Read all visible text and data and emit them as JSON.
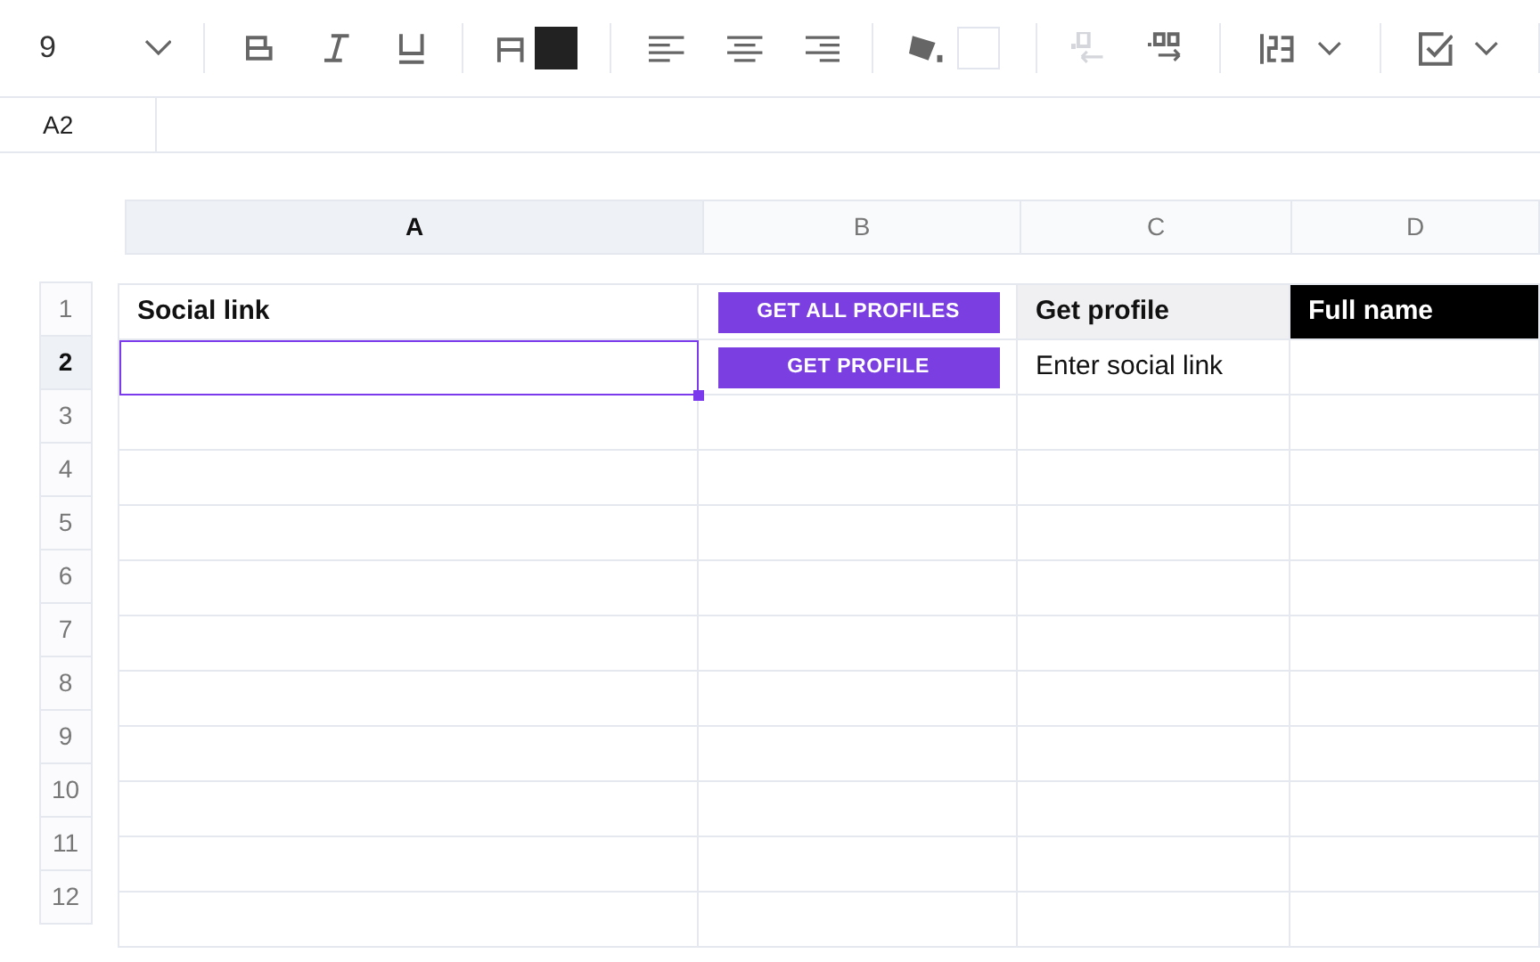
{
  "toolbar": {
    "font_size": "9",
    "decrease_decimals_disabled": true
  },
  "formula_bar": {
    "cell_ref": "A2"
  },
  "columns": [
    {
      "label": "A",
      "selected": true
    },
    {
      "label": "B",
      "selected": false
    },
    {
      "label": "C",
      "selected": false
    },
    {
      "label": "D",
      "selected": false
    }
  ],
  "rows": [
    {
      "number": "1",
      "selected": false,
      "cells": [
        {
          "kind": "bold",
          "text": "Social link"
        },
        {
          "kind": "button",
          "text": "GET ALL PROFILES"
        },
        {
          "kind": "header_light",
          "text": "Get profile"
        },
        {
          "kind": "header_dark",
          "text": "Full name"
        }
      ]
    },
    {
      "number": "2",
      "selected": true,
      "cells": [
        {
          "kind": "empty"
        },
        {
          "kind": "button",
          "text": "GET PROFILE"
        },
        {
          "kind": "text",
          "text": "Enter social link"
        },
        {
          "kind": "empty"
        }
      ]
    },
    {
      "number": "3",
      "selected": false,
      "cells": []
    },
    {
      "number": "4",
      "selected": false,
      "cells": []
    },
    {
      "number": "5",
      "selected": false,
      "cells": []
    },
    {
      "number": "6",
      "selected": false,
      "cells": []
    },
    {
      "number": "7",
      "selected": false,
      "cells": []
    },
    {
      "number": "8",
      "selected": false,
      "cells": []
    },
    {
      "number": "9",
      "selected": false,
      "cells": []
    },
    {
      "number": "10",
      "selected": false,
      "cells": []
    },
    {
      "number": "11",
      "selected": false,
      "cells": []
    },
    {
      "number": "12",
      "selected": false,
      "cells": []
    }
  ]
}
